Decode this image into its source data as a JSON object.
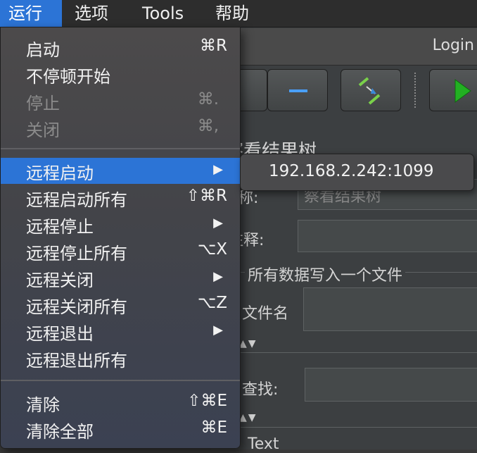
{
  "menubar": {
    "items": [
      {
        "label": "运行"
      },
      {
        "label": "选项"
      },
      {
        "label": "Tools"
      },
      {
        "label": "帮助"
      }
    ]
  },
  "window": {
    "title": "Login",
    "panel_title": "察看结果树",
    "name_label": "名称:",
    "name_value": "察看结果树",
    "comment_label": "注释:",
    "write_all_label": "所有数据写入一个文件",
    "filename_label": "文件名",
    "search_label": "查找:",
    "text_label": "Text"
  },
  "menu": {
    "items": [
      {
        "label": "启动",
        "shortcut": "⌘R"
      },
      {
        "label": "不停顿开始",
        "shortcut": ""
      },
      {
        "label": "停止",
        "shortcut": "⌘."
      },
      {
        "label": "关闭",
        "shortcut": "⌘,"
      },
      {
        "label": "远程启动",
        "shortcut": ""
      },
      {
        "label": "远程启动所有",
        "shortcut": "⇧⌘R"
      },
      {
        "label": "远程停止",
        "shortcut": ""
      },
      {
        "label": "远程停止所有",
        "shortcut": "⌥X"
      },
      {
        "label": "远程关闭",
        "shortcut": ""
      },
      {
        "label": "远程关闭所有",
        "shortcut": "⌥Z"
      },
      {
        "label": "远程退出",
        "shortcut": ""
      },
      {
        "label": "远程退出所有",
        "shortcut": ""
      },
      {
        "label": "清除",
        "shortcut": "⇧⌘E"
      },
      {
        "label": "清除全部",
        "shortcut": "⌘E"
      }
    ],
    "submenu_arrow": "▶"
  },
  "submenu": {
    "items": [
      {
        "label": "192.168.2.242:1099"
      }
    ]
  },
  "colors": {
    "highlight": "#2c74d6",
    "run_icon": "#22b022"
  },
  "icons": {
    "toolbar": [
      "expand-icon",
      "collapse-icon",
      "toggle-icon",
      "start-run-icon"
    ]
  }
}
